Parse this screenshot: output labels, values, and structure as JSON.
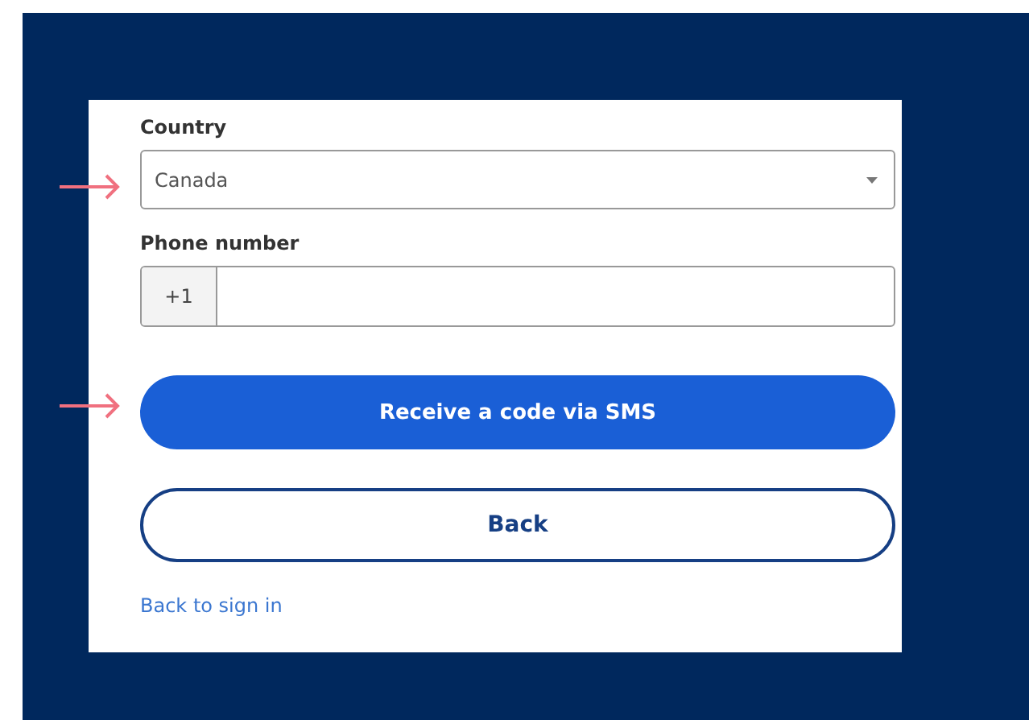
{
  "form": {
    "country": {
      "label": "Country",
      "value": "Canada"
    },
    "phone": {
      "label": "Phone number",
      "prefix": "+1"
    },
    "primary_button": "Receive a code via SMS",
    "secondary_button": "Back",
    "link": "Back to sign in"
  }
}
